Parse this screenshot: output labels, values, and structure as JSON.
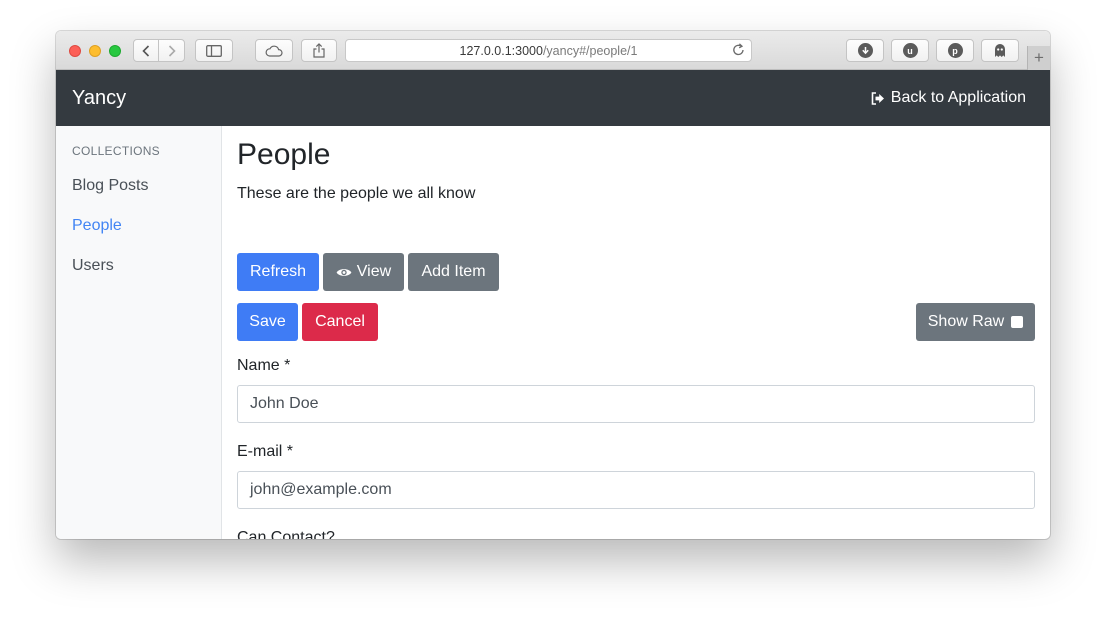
{
  "browser": {
    "url_host": "127.0.0.1:3000",
    "url_path": "/yancy#/people/1",
    "extensions": [
      "download-icon",
      "ublock-icon",
      "pinterest-icon",
      "ghostery-icon"
    ],
    "new_tab": "+"
  },
  "navbar": {
    "brand": "Yancy",
    "back_label": "Back to Application"
  },
  "sidebar": {
    "heading": "COLLECTIONS",
    "items": [
      {
        "label": "Blog Posts",
        "active": false
      },
      {
        "label": "People",
        "active": true
      },
      {
        "label": "Users",
        "active": false
      }
    ]
  },
  "main": {
    "title": "People",
    "description": "These are the people we all know",
    "toolbar": {
      "refresh_label": "Refresh",
      "view_label": "View",
      "add_label": "Add Item"
    },
    "form": {
      "save_label": "Save",
      "cancel_label": "Cancel",
      "show_raw_label": "Show Raw",
      "fields": {
        "name": {
          "label": "Name *",
          "value": "John Doe"
        },
        "email": {
          "label": "E-mail *",
          "value": "john@example.com"
        },
        "can_contact": {
          "label": "Can Contact?"
        }
      }
    }
  },
  "colors": {
    "navbar": "#343a40",
    "primary": "#3f7cf5",
    "secondary": "#6c757d",
    "danger": "#dc2a4a",
    "active_link": "#4285f4"
  }
}
